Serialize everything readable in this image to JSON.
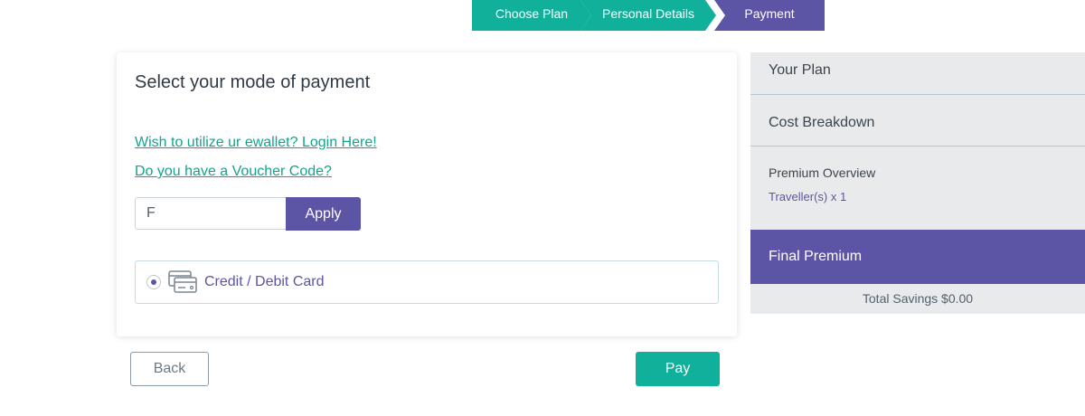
{
  "stepper": {
    "steps": [
      "Choose Plan",
      "Personal Details",
      "Payment"
    ],
    "active_index": 2,
    "colors": {
      "completed": "#11b09a",
      "active": "#5c55a6"
    }
  },
  "payment": {
    "title": "Select your mode of payment",
    "ewallet_link": "Wish to utilize ur ewallet? Login Here!",
    "voucher_link": "Do you have a Voucher Code?",
    "voucher_input_value": "F",
    "apply_label": "Apply",
    "options": [
      {
        "label": "Credit / Debit Card",
        "icon": "credit-card-icon",
        "selected": true
      }
    ]
  },
  "actions": {
    "back_label": "Back",
    "pay_label": "Pay"
  },
  "summary": {
    "your_plan": "Your Plan",
    "cost_breakdown": "Cost Breakdown",
    "premium_overview": "Premium Overview",
    "travellers": "Traveller(s) x 1",
    "final_premium": "Final Premium",
    "total_savings": "Total Savings $0.00"
  },
  "colors": {
    "accent_teal": "#11b09a",
    "accent_purple": "#5c55a6",
    "sidebar_bg": "#e9eaeb"
  }
}
